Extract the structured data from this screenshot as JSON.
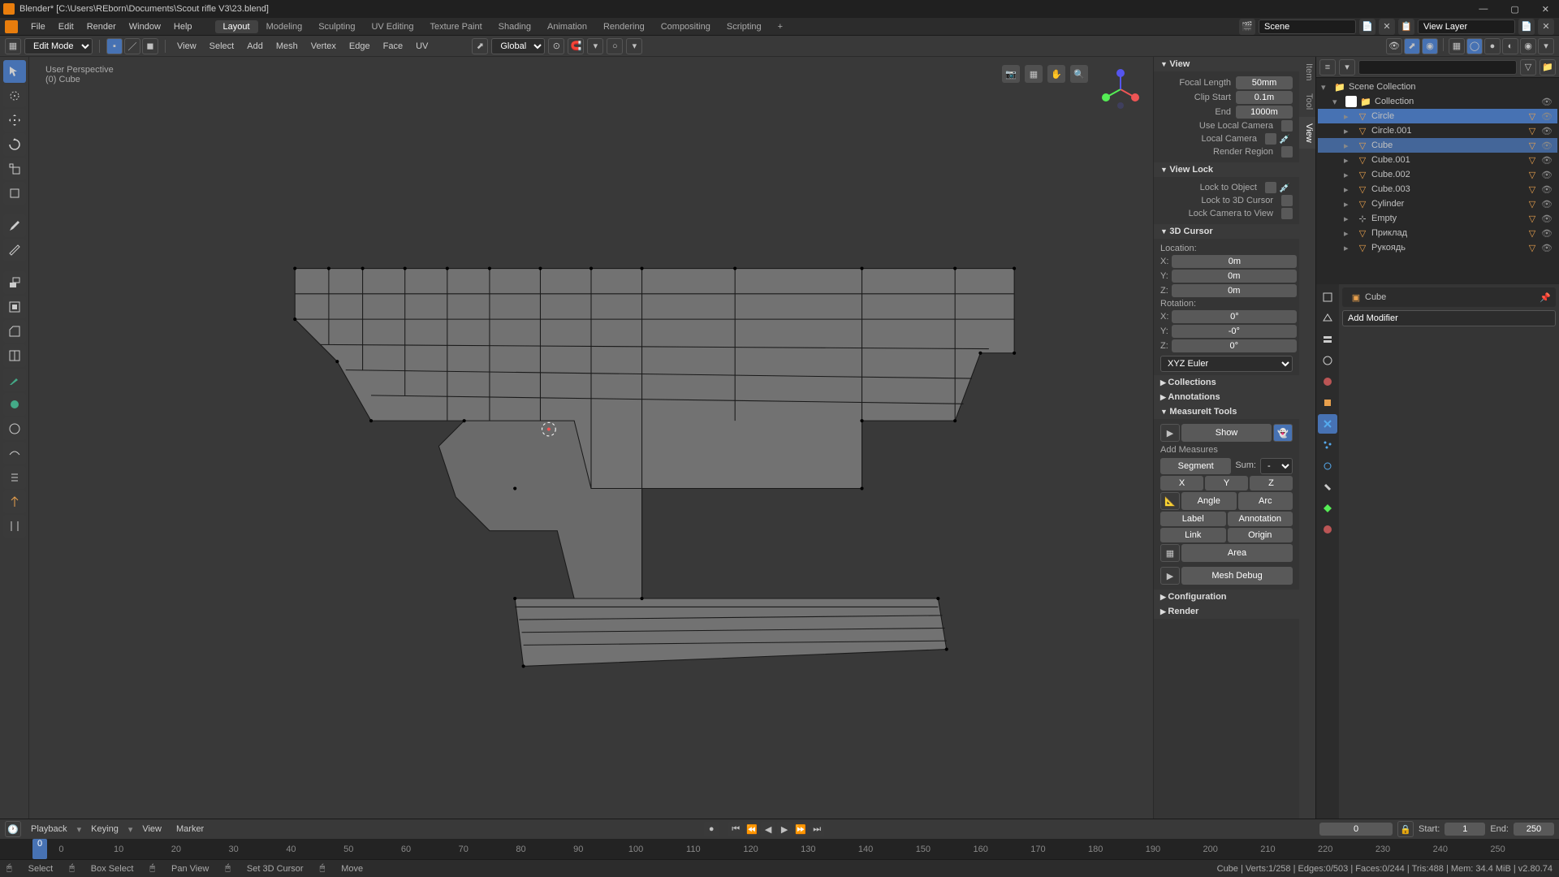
{
  "title": "Blender* [C:\\Users\\REborn\\Documents\\Scout rifle V3\\23.blend]",
  "menubar": [
    "File",
    "Edit",
    "Render",
    "Window",
    "Help"
  ],
  "workspaces": [
    "Layout",
    "Modeling",
    "Sculpting",
    "UV Editing",
    "Texture Paint",
    "Shading",
    "Animation",
    "Rendering",
    "Compositing",
    "Scripting"
  ],
  "active_workspace": "Layout",
  "scene_name": "Scene",
  "view_layer": "View Layer",
  "mode": "Edit Mode",
  "view_header_menus": [
    "View",
    "Select",
    "Add",
    "Mesh",
    "Vertex",
    "Edge",
    "Face",
    "UV"
  ],
  "orientation": "Global",
  "viewport_info": {
    "perspective": "User Perspective",
    "object": "(0) Cube"
  },
  "n_panel": {
    "tabs": [
      "Item",
      "Tool",
      "View"
    ],
    "active_tab": "View",
    "view": {
      "focal_length": "50mm",
      "clip_start": "0.1m",
      "clip_end": "1000m",
      "use_local_camera_label": "Use Local Camera",
      "local_camera_label": "Local Camera",
      "render_region_label": "Render Region"
    },
    "view_lock": {
      "lock_to_object": "Lock to Object",
      "lock_3d_cursor": "Lock to 3D Cursor",
      "lock_camera": "Lock Camera to View"
    },
    "cursor": {
      "location_label": "Location:",
      "x": "0m",
      "y": "0m",
      "z": "0m",
      "rotation_label": "Rotation:",
      "rx": "0°",
      "ry": "-0°",
      "rz": "0°",
      "rot_mode": "XYZ Euler"
    },
    "collections_label": "Collections",
    "annotations_label": "Annotations",
    "measureit": {
      "title": "MeasureIt Tools",
      "show": "Show",
      "add_measures": "Add Measures",
      "segment": "Segment",
      "sum": "Sum:",
      "sum_val": "-",
      "x": "X",
      "y": "Y",
      "z": "Z",
      "angle": "Angle",
      "arc": "Arc",
      "label": "Label",
      "annotation": "Annotation",
      "link": "Link",
      "origin": "Origin",
      "area": "Area",
      "mesh_debug": "Mesh Debug",
      "configuration": "Configuration",
      "render": "Render"
    }
  },
  "outliner": {
    "root": "Scene Collection",
    "collection": "Collection",
    "items": [
      {
        "name": "Circle",
        "selected": true
      },
      {
        "name": "Circle.001"
      },
      {
        "name": "Cube",
        "active": true
      },
      {
        "name": "Cube.001"
      },
      {
        "name": "Cube.002"
      },
      {
        "name": "Cube.003"
      },
      {
        "name": "Cylinder"
      },
      {
        "name": "Empty",
        "type": "empty"
      },
      {
        "name": "Приклад"
      },
      {
        "name": "Рукоядь"
      }
    ]
  },
  "properties": {
    "breadcrumb": "Cube",
    "add_modifier": "Add Modifier"
  },
  "timeline": {
    "menus": [
      "Playback",
      "Keying",
      "View",
      "Marker"
    ],
    "current": "0",
    "start_label": "Start:",
    "start": "1",
    "end_label": "End:",
    "end": "250",
    "ticks": [
      "0",
      "10",
      "20",
      "30",
      "40",
      "50",
      "60",
      "70",
      "80",
      "90",
      "100",
      "110",
      "120",
      "130",
      "140",
      "150",
      "160",
      "170",
      "180",
      "190",
      "200",
      "210",
      "220",
      "230",
      "240",
      "250"
    ]
  },
  "statusbar": {
    "select": "Select",
    "box_select": "Box Select",
    "pan_view": "Pan View",
    "set_cursor": "Set 3D Cursor",
    "move": "Move",
    "stats": "Cube | Verts:1/258 | Edges:0/503 | Faces:0/244 | Tris:488 | Mem: 34.4 MiB | v2.80.74"
  }
}
